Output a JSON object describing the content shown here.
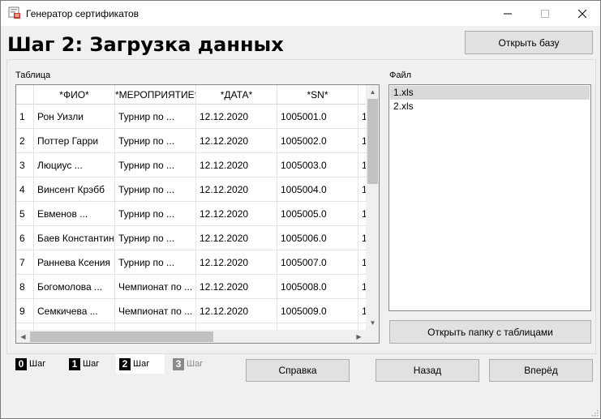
{
  "window": {
    "title": "Генератор сертификатов",
    "app_icon": "certificate-icon",
    "controls": [
      "minimize-icon",
      "maximize-icon",
      "close-icon"
    ]
  },
  "heading": "Шаг 2: Загрузка данных",
  "open_db_label": "Открыть базу",
  "table_label": "Таблица",
  "file_label": "Файл",
  "table": {
    "columns": [
      "*ФИО*",
      "*МЕРОПРИЯТИЕ*",
      "*ДАТА*",
      "*SN*",
      ""
    ],
    "rows": [
      {
        "num": "1",
        "cells": [
          "Рон Уизли",
          "Турнир по ...",
          "12.12.2020",
          "1005001.0",
          "1"
        ]
      },
      {
        "num": "2",
        "cells": [
          "Поттер Гарри",
          "Турнир по ...",
          "12.12.2020",
          "1005002.0",
          "1"
        ]
      },
      {
        "num": "3",
        "cells": [
          "Люциус ...",
          "Турнир по ...",
          "12.12.2020",
          "1005003.0",
          "1"
        ]
      },
      {
        "num": "4",
        "cells": [
          "Винсент Крэбб",
          "Турнир по ...",
          "12.12.2020",
          "1005004.0",
          "1"
        ]
      },
      {
        "num": "5",
        "cells": [
          "Евменов ...",
          "Турнир по ...",
          "12.12.2020",
          "1005005.0",
          "1"
        ]
      },
      {
        "num": "6",
        "cells": [
          "Баев Константин",
          "Турнир по ...",
          "12.12.2020",
          "1005006.0",
          "1"
        ]
      },
      {
        "num": "7",
        "cells": [
          "Раннева Ксения",
          "Турнир по ...",
          "12.12.2020",
          "1005007.0",
          "1"
        ]
      },
      {
        "num": "8",
        "cells": [
          "Богомолова ...",
          "Чемпионат по ...",
          "12.12.2020",
          "1005008.0",
          "1"
        ]
      },
      {
        "num": "9",
        "cells": [
          "Семкичева ...",
          "Чемпионат по ...",
          "12.12.2020",
          "1005009.0",
          "1"
        ]
      }
    ]
  },
  "files": {
    "items": [
      "1.xls",
      "2.xls"
    ],
    "selected_index": 0
  },
  "open_folder_label": "Открыть папку с таблицами",
  "tabs": [
    {
      "num": "0",
      "label": "Шаг",
      "state": "normal"
    },
    {
      "num": "1",
      "label": "Шаг",
      "state": "normal"
    },
    {
      "num": "2",
      "label": "Шаг",
      "state": "active"
    },
    {
      "num": "3",
      "label": "Шаг",
      "state": "disabled"
    }
  ],
  "buttons": {
    "help": "Справка",
    "back": "Назад",
    "next": "Вперёд"
  }
}
